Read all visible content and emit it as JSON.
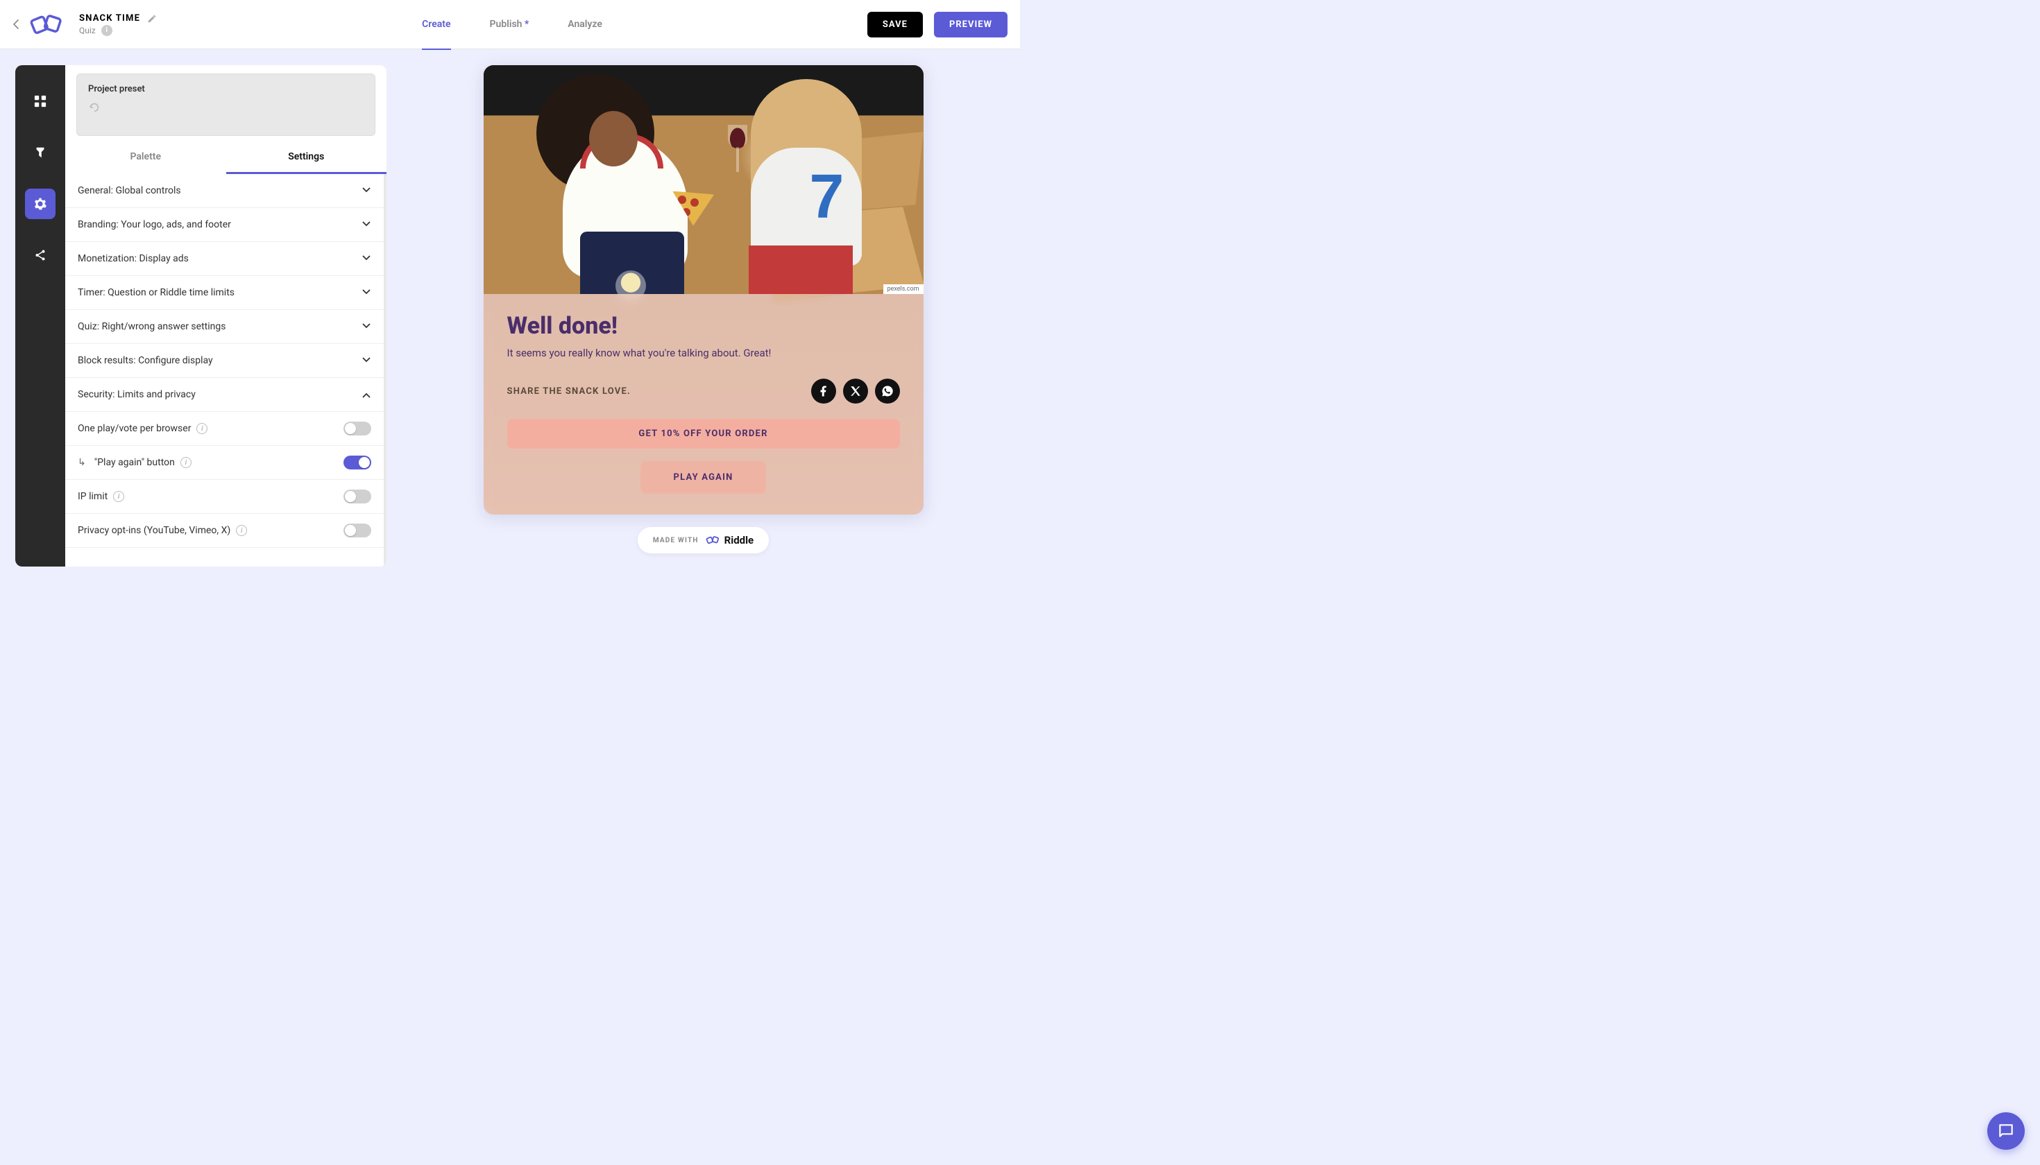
{
  "header": {
    "project_title": "SNACK TIME",
    "project_subtitle": "Quiz",
    "nav": {
      "create": "Create",
      "publish": "Publish",
      "publish_flag": "*",
      "analyze": "Analyze"
    },
    "save_label": "SAVE",
    "preview_label": "PREVIEW"
  },
  "panel": {
    "preset_label": "Project preset",
    "tabs": {
      "palette": "Palette",
      "settings": "Settings"
    },
    "accordions": [
      {
        "key": "general",
        "label": "General: Global controls",
        "open": false
      },
      {
        "key": "branding",
        "label": "Branding: Your logo, ads, and footer",
        "open": false
      },
      {
        "key": "monet",
        "label": "Monetization: Display ads",
        "open": false
      },
      {
        "key": "timer",
        "label": "Timer: Question or Riddle time limits",
        "open": false
      },
      {
        "key": "quiz",
        "label": "Quiz: Right/wrong answer settings",
        "open": false
      },
      {
        "key": "block",
        "label": "Block results: Configure display",
        "open": false
      },
      {
        "key": "security",
        "label": "Security: Limits and privacy",
        "open": true
      }
    ],
    "security_settings": [
      {
        "key": "one_play",
        "label": "One play/vote per browser",
        "indent": false,
        "info": true,
        "on": false
      },
      {
        "key": "play_again",
        "label": "\"Play again\" button",
        "indent": true,
        "info": true,
        "on": true
      },
      {
        "key": "ip_limit",
        "label": "IP limit",
        "indent": false,
        "info": true,
        "on": false
      },
      {
        "key": "privacy",
        "label": "Privacy opt-ins (YouTube, Vimeo, X)",
        "indent": false,
        "info": true,
        "on": false
      }
    ]
  },
  "preview": {
    "image_credit": "pexels.com",
    "result_title": "Well done!",
    "result_desc": "It seems you really know what you're talking about. Great!",
    "share_label": "SHARE THE SNACK LOVE.",
    "cta_label": "GET 10% OFF YOUR ORDER",
    "play_again_label": "PLAY AGAIN",
    "made_with_prefix": "MADE WITH",
    "made_with_brand": "Riddle"
  }
}
